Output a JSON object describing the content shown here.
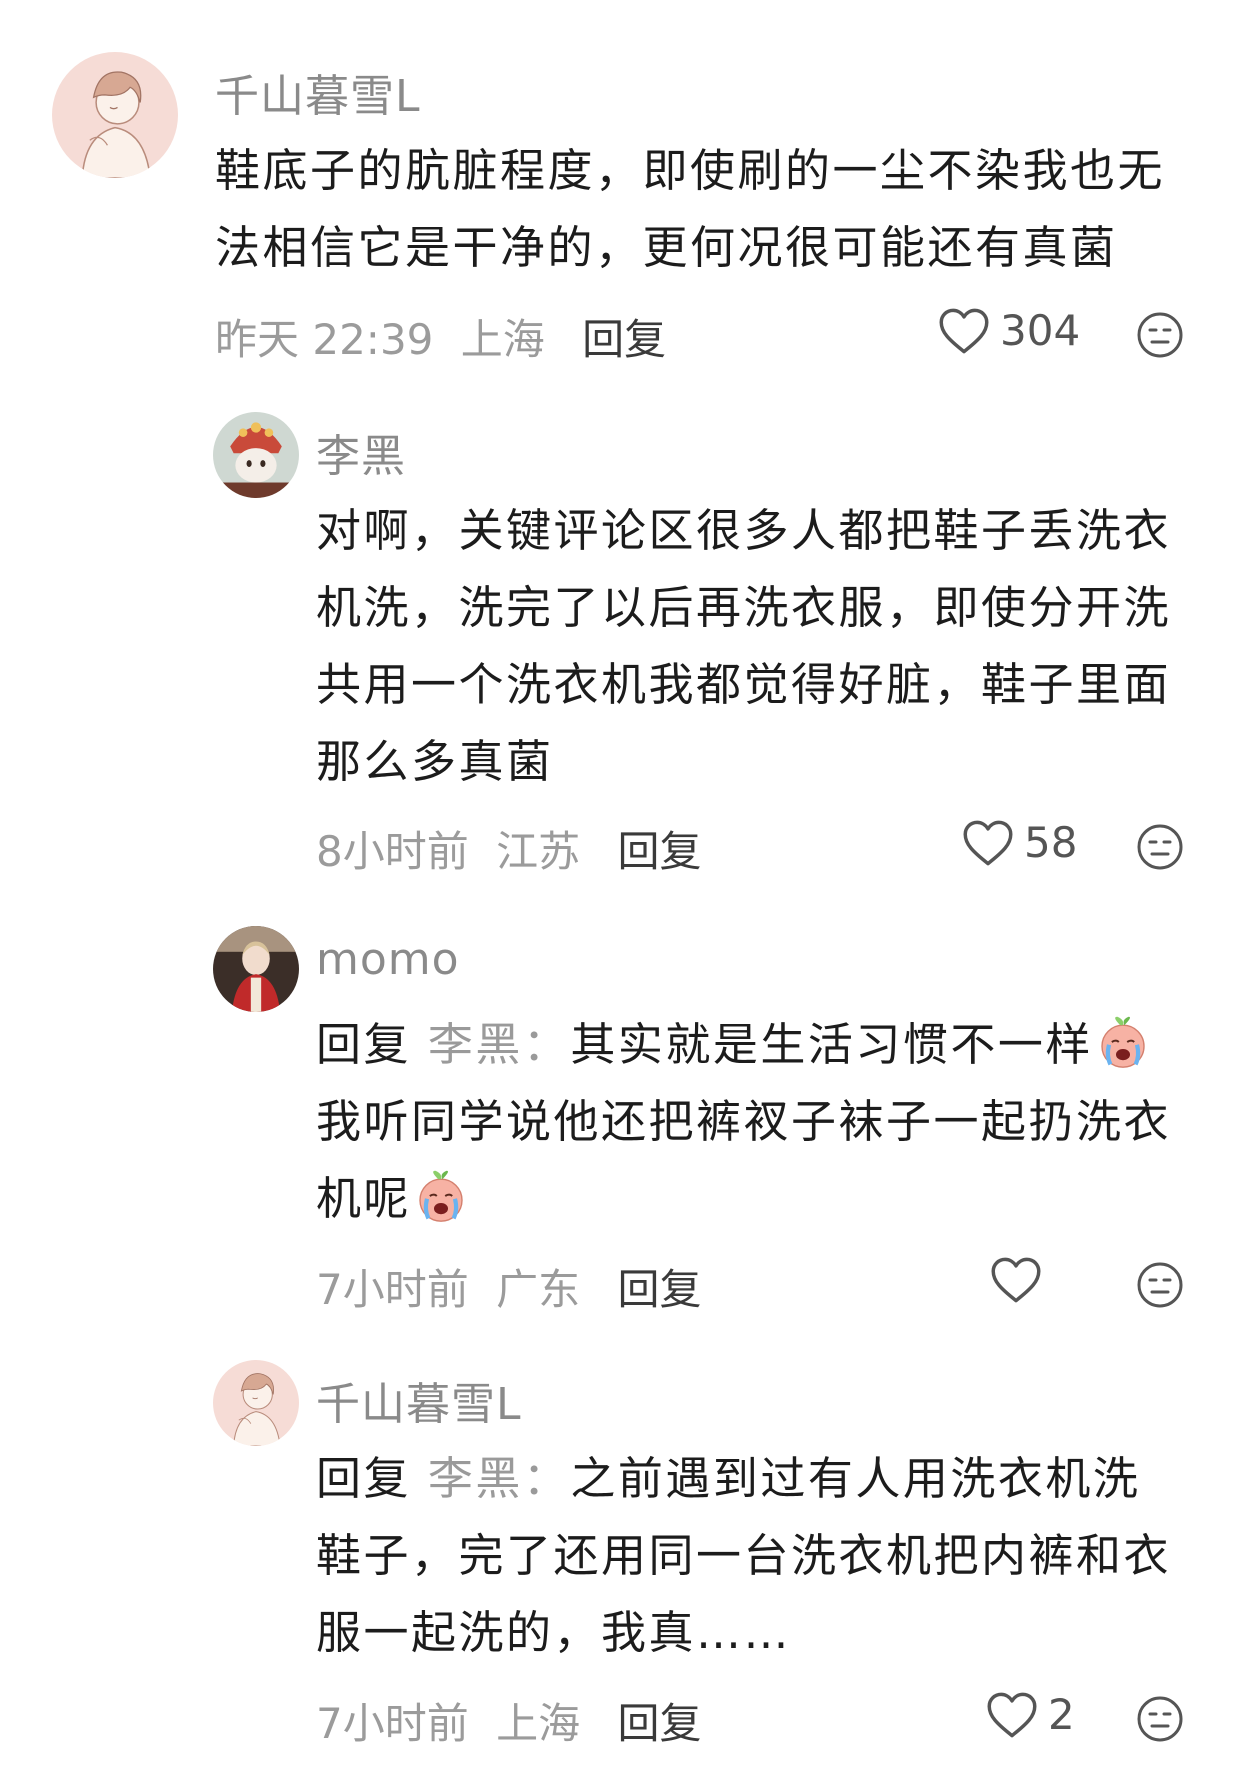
{
  "comments": [
    {
      "username": "千山暮雪L",
      "lines": [
        "鞋底子的肮脏程度，即使刷的一尘不染我也无",
        "法相信它是干净的，更何况很可能还有真菌"
      ],
      "time": "昨天 22:39",
      "location": "上海",
      "reply_label": "回复",
      "likes": "304"
    },
    {
      "username": "李黑",
      "lines": [
        "对啊，关键评论区很多人都把鞋子丢洗衣",
        "机洗，洗完了以后再洗衣服，即使分开洗",
        "共用一个洗衣机我都觉得好脏，鞋子里面",
        "那么多真菌"
      ],
      "time": "8小时前",
      "location": "江苏",
      "reply_label": "回复",
      "likes": "58"
    },
    {
      "username": "momo",
      "reply_prefix": "回复",
      "reply_target": "李黑：",
      "lines": [
        "其实就是生活习惯不一样",
        "我听同学说他还把裤衩子袜子一起扔洗衣",
        "机呢"
      ],
      "time": "7小时前",
      "location": "广东",
      "reply_label": "回复",
      "likes": ""
    },
    {
      "username": "千山暮雪L",
      "reply_prefix": "回复",
      "reply_target": "李黑：",
      "lines": [
        "之前遇到过有人用洗衣机洗",
        "鞋子，完了还用同一台洗衣机把内裤和衣",
        "服一起洗的，我真……"
      ],
      "time": "7小时前",
      "location": "上海",
      "reply_label": "回复",
      "likes": "2"
    }
  ],
  "icons": {
    "like": "heart-outline-icon",
    "dislike": "meh-face-icon",
    "emoji": "crying-peach-emoji"
  },
  "colors": {
    "text": "#1c1c1c",
    "muted": "#9b9b9b",
    "avatar_pink": "#f6dcd6"
  }
}
